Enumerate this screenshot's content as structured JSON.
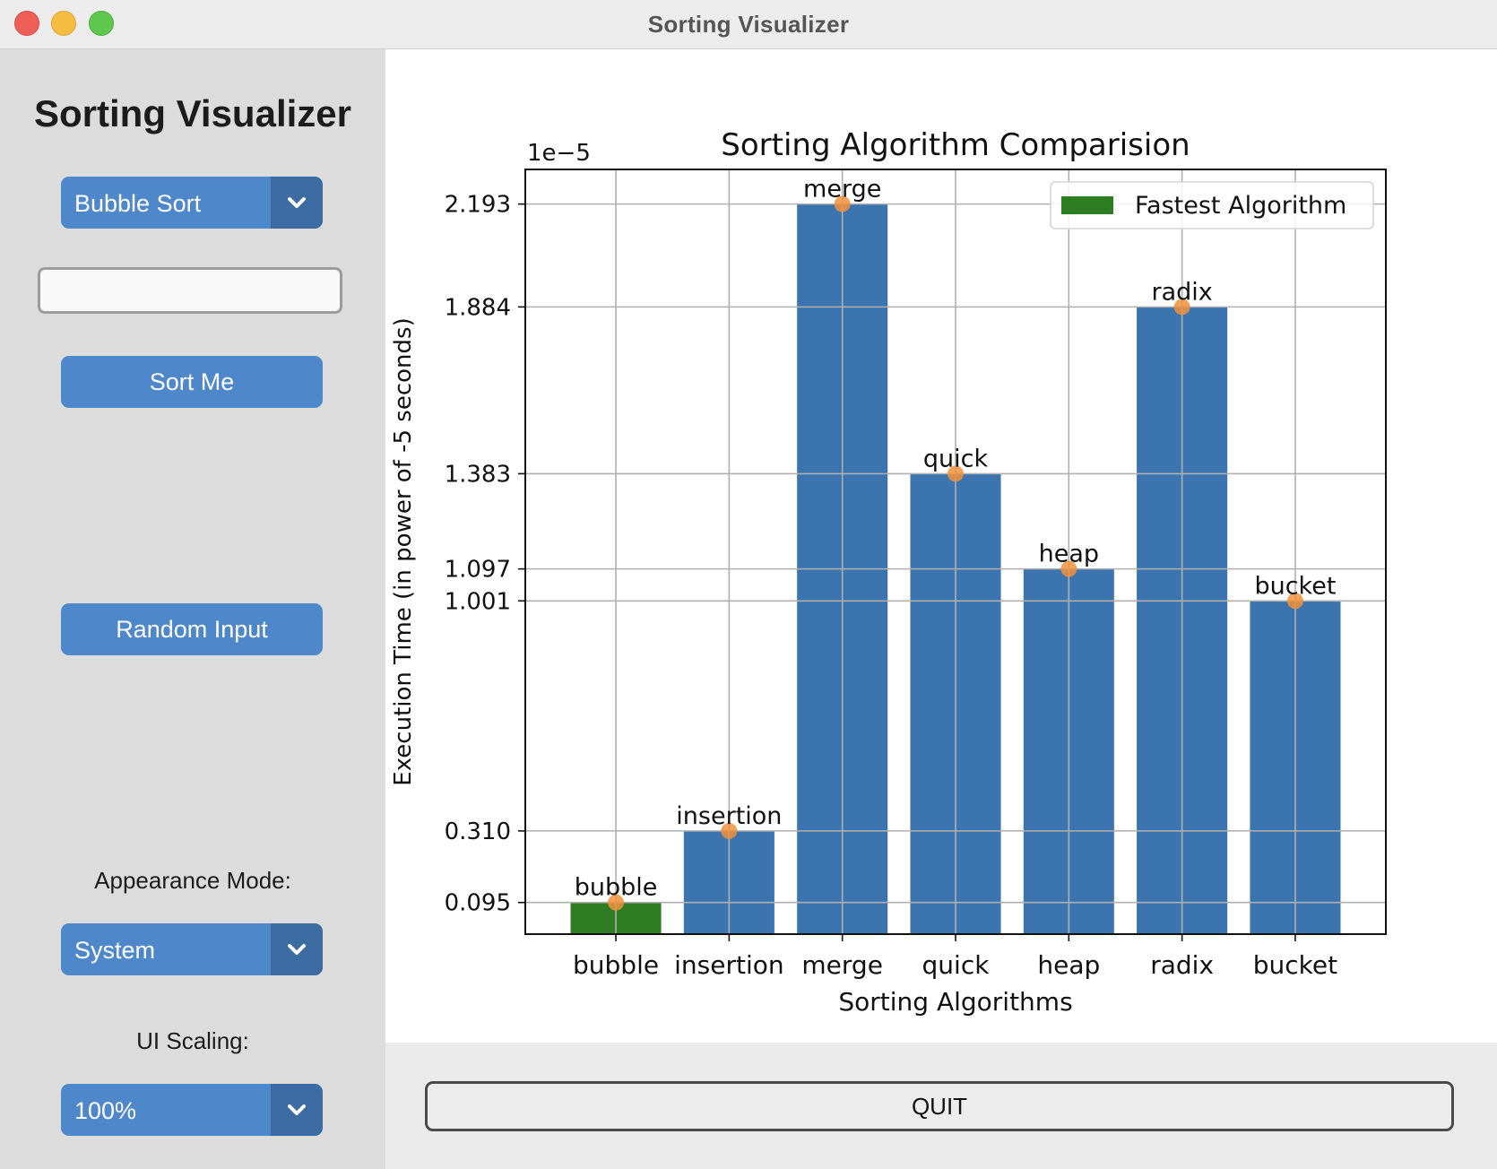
{
  "window": {
    "title": "Sorting Visualizer"
  },
  "sidebar": {
    "title": "Sorting Visualizer",
    "algorithm_select": {
      "value": "Bubble Sort"
    },
    "input_field": {
      "value": "",
      "placeholder": ""
    },
    "sort_button": "Sort Me",
    "random_button": "Random Input",
    "appearance_label": "Appearance Mode:",
    "appearance_select": {
      "value": "System"
    },
    "scaling_label": "UI Scaling:",
    "scaling_select": {
      "value": "100%"
    }
  },
  "quit_button": "QUIT",
  "colors": {
    "accent": "#4e87ca",
    "accent_dark": "#3d6ca3",
    "bar": "#3b74ae",
    "fastest_bar": "#2e7d22",
    "marker": "#f0923c"
  },
  "chart_data": {
    "type": "bar",
    "title": "Sorting Algorithm Comparision",
    "xlabel": "Sorting Algorithms",
    "ylabel": "Execution Time (in power of -5 seconds)",
    "offset_label": "1e−5",
    "categories": [
      "bubble",
      "insertion",
      "merge",
      "quick",
      "heap",
      "radix",
      "bucket"
    ],
    "values": [
      0.095,
      0.31,
      2.193,
      1.383,
      1.097,
      1.884,
      1.001
    ],
    "bar_labels": [
      "bubble",
      "insertion",
      "merge",
      "quick",
      "heap",
      "radix",
      "bucket"
    ],
    "yticks": [
      0.095,
      0.31,
      1.001,
      1.097,
      1.383,
      1.884,
      2.193
    ],
    "ytick_labels": [
      "0.095",
      "0.310",
      "1.001",
      "1.097",
      "1.383",
      "1.884",
      "2.193"
    ],
    "ylim": [
      0,
      2.297
    ],
    "fastest_index": 0,
    "legend": {
      "label": "Fastest Algorithm",
      "position": "upper right"
    },
    "grid": true
  }
}
